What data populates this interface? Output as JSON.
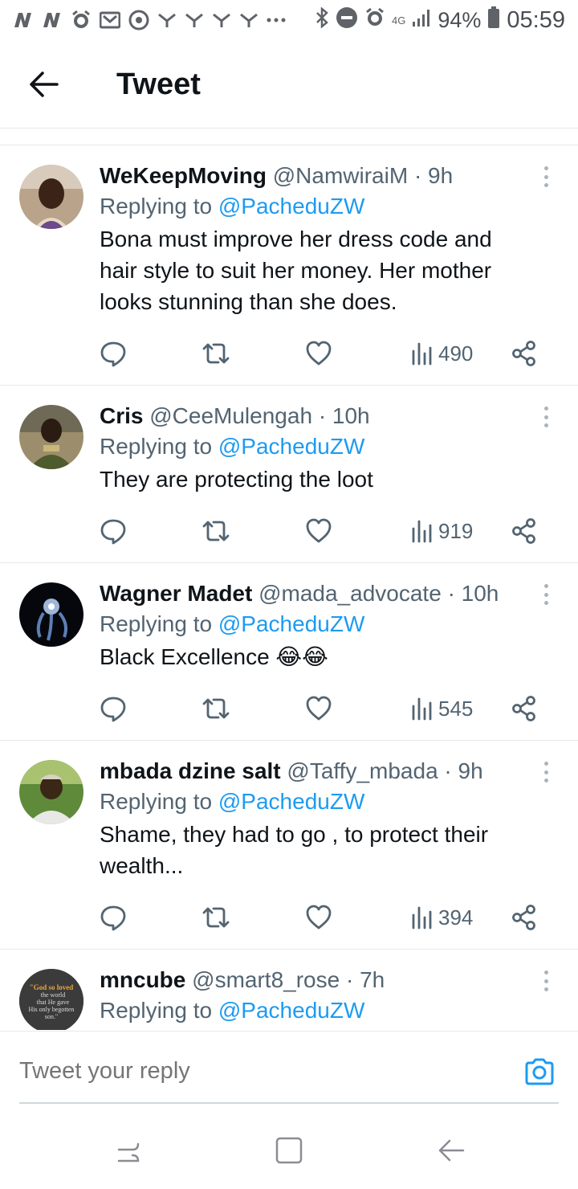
{
  "status_bar": {
    "battery_percent": "94%",
    "time": "05:59",
    "network": "4G",
    "icons": [
      "n-icon",
      "n-icon",
      "alarm-icon",
      "mail-icon",
      "chrome-icon",
      "wifi-icon",
      "wifi-icon",
      "wifi-icon",
      "wifi-icon",
      "more-dots-icon",
      "bluetooth-icon",
      "do-not-disturb-icon",
      "alarm-icon",
      "signal-icon",
      "battery-icon"
    ]
  },
  "header": {
    "title": "Tweet",
    "back_icon": "arrow-left-icon"
  },
  "tweets": [
    {
      "name": "WeKeepMoving",
      "handle": "@NamwiraiM",
      "time": "· 9h",
      "replying_prefix": "Replying to",
      "mention": "@PacheduZW",
      "text": "Bona must improve her dress code and hair style to suit her money. Her mother looks stunning than she does.",
      "views": "490"
    },
    {
      "name": "Cris",
      "handle": "@CeeMulengah",
      "time": "· 10h",
      "replying_prefix": "Replying to",
      "mention": "@PacheduZW",
      "text": "They are protecting the loot",
      "views": "919"
    },
    {
      "name": "Wagner Madet",
      "handle": "@mada_advocate",
      "time": "· 10h",
      "replying_prefix": "Replying to",
      "mention": "@PacheduZW",
      "text": "Black Excellence 😂😂",
      "views": "545"
    },
    {
      "name": "mbada dzine salt",
      "handle": "@Taffy_mbada",
      "time": "· 9h",
      "replying_prefix": "Replying to",
      "mention": "@PacheduZW",
      "text": "Shame, they had to go , to protect their wealth...",
      "views": "394"
    },
    {
      "name": "mncube",
      "handle": "@smart8_rose",
      "time": "· 7h",
      "replying_prefix": "Replying to",
      "mention": "@PacheduZW",
      "text": "",
      "views": "",
      "avatar_text": [
        "\"God so loved",
        "the world",
        "that He gave",
        "His only begotten",
        "son.\""
      ]
    }
  ],
  "reply_box": {
    "placeholder": "Tweet your reply",
    "camera_icon": "camera-icon"
  },
  "navbar": {
    "icons": [
      "recent-apps-icon",
      "home-icon",
      "back-icon"
    ]
  },
  "colors": {
    "accent": "#1d9bf0",
    "text": "#0f1419",
    "muted": "#536471",
    "border": "#e6e9ec"
  }
}
